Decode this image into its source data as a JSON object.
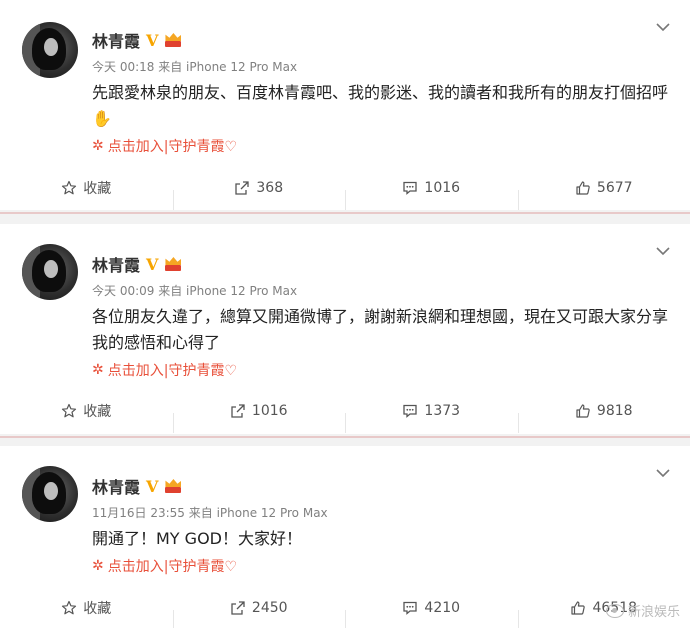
{
  "posts": [
    {
      "name": "林青霞",
      "verified": "V",
      "time": "今天 00:18",
      "source": "来自 iPhone 12 Pro Max",
      "text": "先跟愛林泉的朋友、百度林青霞吧、我的影迷、我的讀者和我所有的朋友打個招呼",
      "emoji": "✋",
      "join_text": "点击加入|守护青霞♡",
      "favorite_label": "收藏",
      "repost_count": "368",
      "comment_count": "1016",
      "like_count": "5677"
    },
    {
      "name": "林青霞",
      "verified": "V",
      "time": "今天 00:09",
      "source": "来自 iPhone 12 Pro Max",
      "text": "各位朋友久違了，總算又開通微博了，謝謝新浪網和理想國，現在又可跟大家分享我的感悟和心得了",
      "emoji": "",
      "join_text": "点击加入|守护青霞♡",
      "favorite_label": "收藏",
      "repost_count": "1016",
      "comment_count": "1373",
      "like_count": "9818"
    },
    {
      "name": "林青霞",
      "verified": "V",
      "time": "11月16日 23:55",
      "source": "来自 iPhone 12 Pro Max",
      "text": "開通了！MY GOD！大家好！",
      "emoji": "",
      "join_text": "点击加入|守护青霞♡",
      "favorite_label": "收藏",
      "repost_count": "2450",
      "comment_count": "4210",
      "like_count": "46518"
    }
  ],
  "watermark": "新浪娱乐",
  "icons": {
    "favorite": "star-icon",
    "repost": "share-icon",
    "comment": "comment-icon",
    "like": "thumbs-up-icon",
    "more": "chevron-down-icon",
    "join": "flower-icon"
  },
  "colors": {
    "accent": "#e8503a",
    "badge": "#f7a500",
    "divider": "#e8c9c9"
  }
}
